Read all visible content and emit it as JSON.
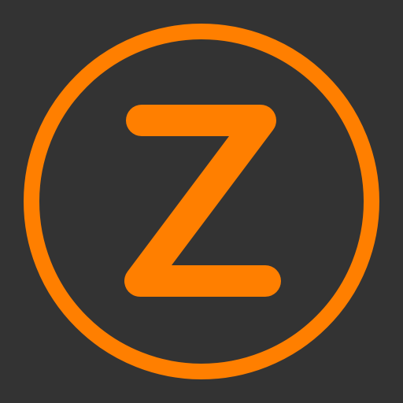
{
  "logo": {
    "letter": "Z",
    "icon": "z-circle-logo"
  },
  "colors": {
    "background": "#333333",
    "accent": "#FF7F00"
  }
}
